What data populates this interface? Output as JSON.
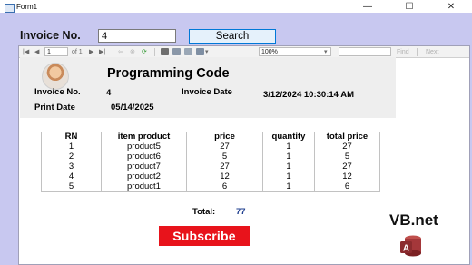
{
  "window": {
    "title": "Form1",
    "controls": {
      "minimize": "—",
      "maximize": "☐",
      "close": "✕"
    }
  },
  "search": {
    "label": "Invoice No.",
    "value": "4",
    "button_label": "Search"
  },
  "toolbar": {
    "page": "1",
    "of_pages": "of 1",
    "zoom": "100%",
    "find_label": "Find",
    "next_label": "Next"
  },
  "report": {
    "company": "Programming Code",
    "invoice_no_label": "Invoice No.",
    "invoice_no": "4",
    "invoice_date_label": "Invoice Date",
    "invoice_date": "3/12/2024 10:30:14 AM",
    "print_date_label": "Print Date",
    "print_date": "05/14/2025",
    "columns": [
      "RN",
      "item product",
      "price",
      "quantity",
      "total price"
    ],
    "rows": [
      [
        "1",
        "product5",
        "27",
        "1",
        "27"
      ],
      [
        "2",
        "product6",
        "5",
        "1",
        "5"
      ],
      [
        "3",
        "product7",
        "27",
        "1",
        "27"
      ],
      [
        "4",
        "product2",
        "12",
        "1",
        "12"
      ],
      [
        "5",
        "product1",
        "6",
        "1",
        "6"
      ]
    ],
    "total_label": "Total:",
    "total_value": "77"
  },
  "overlay": {
    "subscribe": "Subscribe",
    "brand": "VB.net",
    "access_letter": "A"
  },
  "colors": {
    "form_bg": "#c8c8f0",
    "subscribe_bg": "#e8131b",
    "total_color": "#1f3f8f",
    "access_red": "#a4373a"
  }
}
